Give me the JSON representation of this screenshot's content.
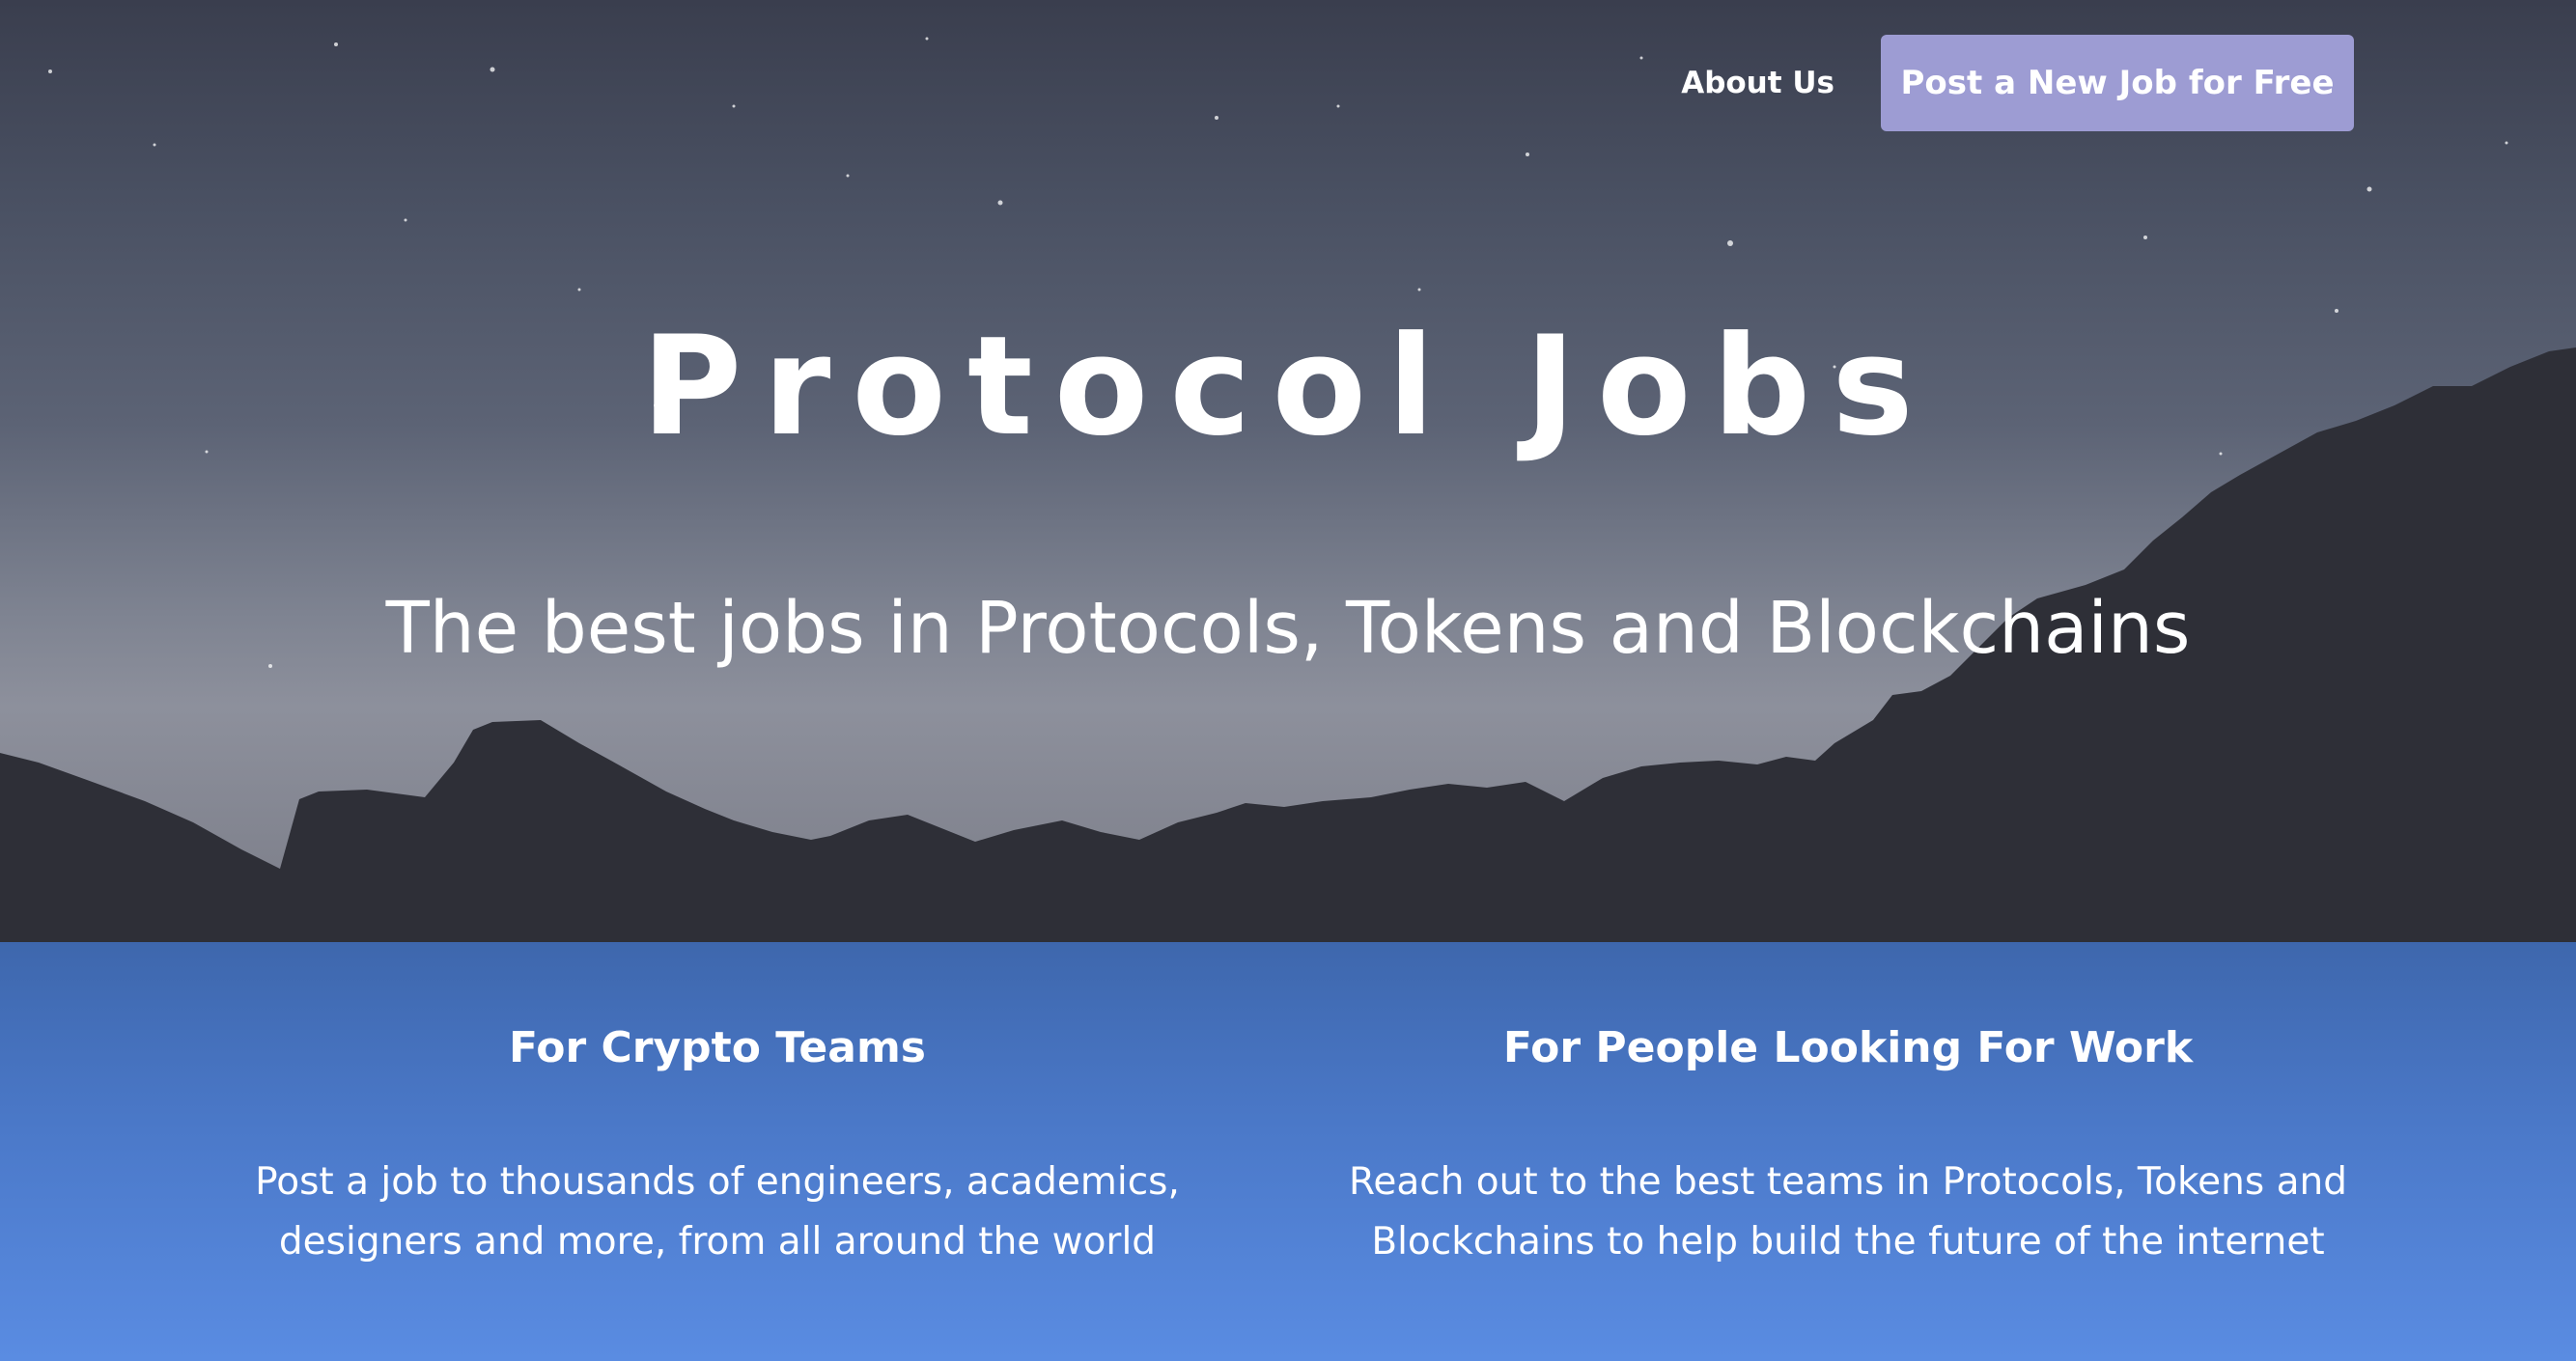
{
  "nav": {
    "about_label": "About Us",
    "post_button_label": "Post a New Job for Free"
  },
  "hero": {
    "title": "Protocol Jobs",
    "subtitle": "The best jobs in Protocols, Tokens and Blockchains"
  },
  "features": {
    "teams": {
      "heading": "For Crypto Teams",
      "line1": "Post a job to thousands of engineers, academics,",
      "line2": "designers and more, from all around the world"
    },
    "seekers": {
      "heading": "For People Looking For Work",
      "line1": "Reach out to the best teams in Protocols, Tokens and",
      "line2": "Blockchains to help build the future of the internet"
    }
  },
  "colors": {
    "button_bg": "#9d9cd3",
    "info_bg_top": "#3e67ad",
    "info_bg_bottom": "#5a8ce2",
    "mountain": "#2e2f37"
  },
  "icons": {
    "background": "night-sky-mountains-image"
  }
}
